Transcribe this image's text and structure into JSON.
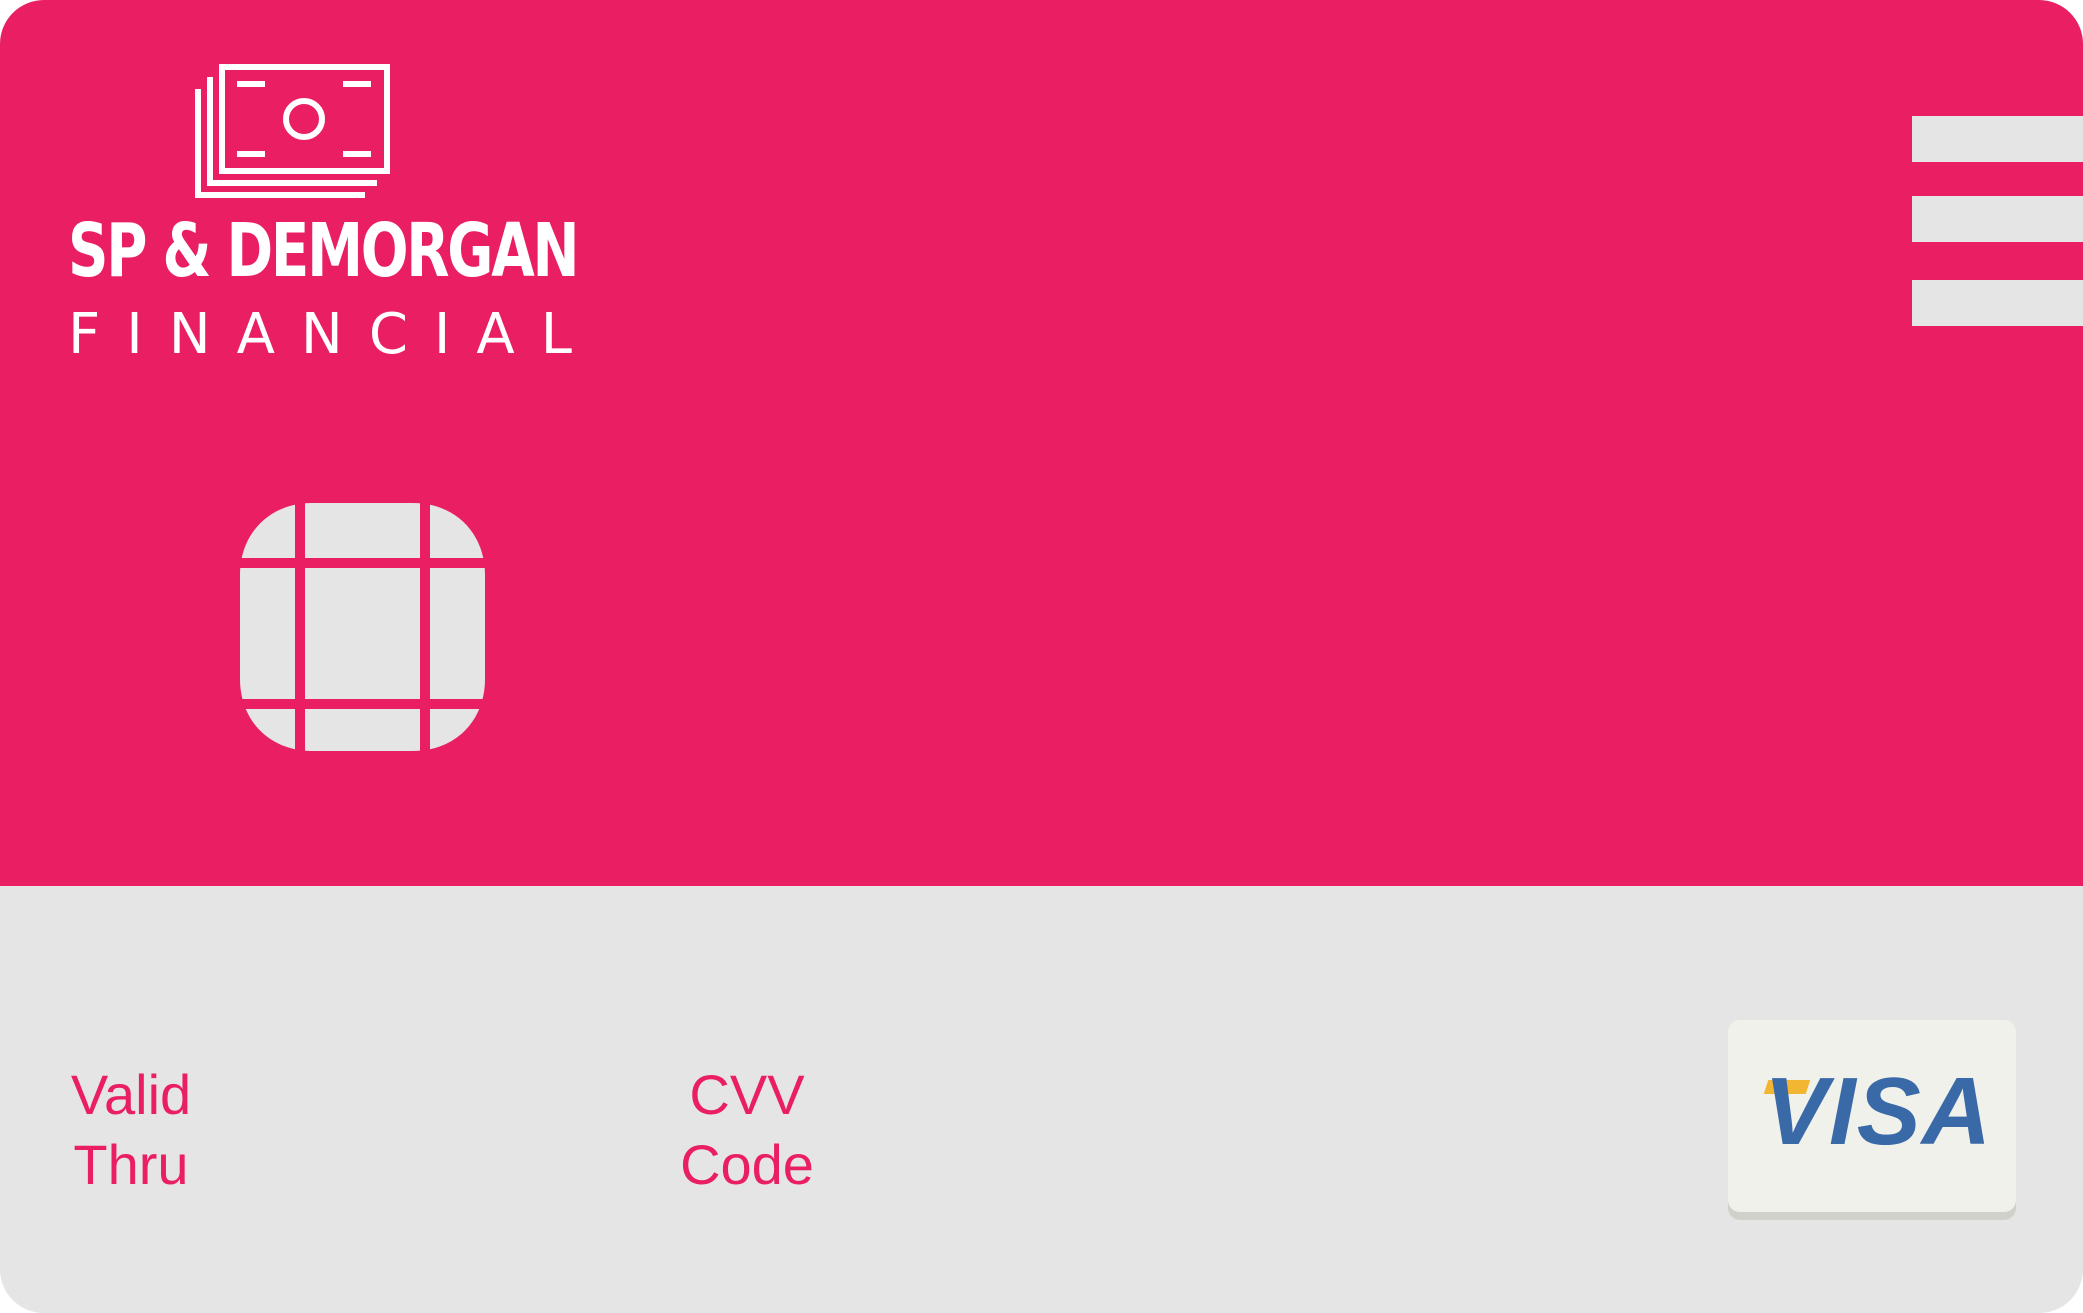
{
  "card": {
    "brand": {
      "line1": "SP & DEMORGAN",
      "line2": "FINANCIAL",
      "logo_icon": "money-stack-icon"
    },
    "menu_icon": "hamburger-menu-icon",
    "chip_icon": "card-chip-icon",
    "fields": {
      "valid_thru": {
        "line1": "Valid",
        "line2": "Thru"
      },
      "cvv": {
        "line1": "CVV",
        "line2": "Code"
      }
    },
    "network": {
      "label": "VISA"
    },
    "colors": {
      "primary": "#ea1f63",
      "secondary": "#e5e5e5",
      "visa_blue": "#3a69a8",
      "visa_gold": "#f2b632",
      "white": "#ffffff"
    }
  }
}
